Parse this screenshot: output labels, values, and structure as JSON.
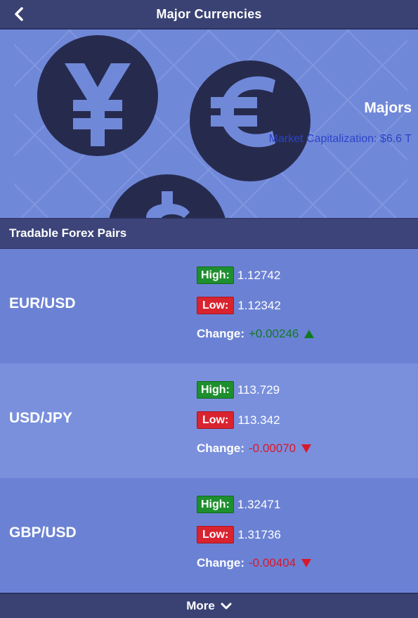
{
  "header": {
    "title": "Major Currencies",
    "back_icon": "chevron-left-icon"
  },
  "hero": {
    "title": "Majors",
    "market_cap": "Market Capitalization: $6.6 T",
    "icons": [
      "yen-coin-icon",
      "euro-coin-icon",
      "dollar-coin-icon"
    ]
  },
  "section": {
    "title": "Tradable Forex Pairs"
  },
  "pairs": [
    {
      "name": "EUR/USD",
      "high_label": "High:",
      "high": "1.12742",
      "low_label": "Low:",
      "low": "1.12342",
      "change_label": "Change:",
      "change": "+0.00246",
      "direction": "up"
    },
    {
      "name": "USD/JPY",
      "high_label": "High:",
      "high": "113.729",
      "low_label": "Low:",
      "low": "113.342",
      "change_label": "Change:",
      "change": "-0.00070",
      "direction": "down"
    },
    {
      "name": "GBP/USD",
      "high_label": "High:",
      "high": "1.32471",
      "low_label": "Low:",
      "low": "1.31736",
      "change_label": "Change:",
      "change": "-0.00404",
      "direction": "down"
    }
  ],
  "footer": {
    "more_label": "More",
    "more_icon": "chevron-down-icon"
  },
  "colors": {
    "header_bg": "#3a4274",
    "hero_bg": "#7088d8",
    "high_badge": "#1e8f2e",
    "low_badge": "#d9232f",
    "change_up": "#117a22",
    "change_down": "#d8182a",
    "market_cap_text": "#2b43c8"
  }
}
